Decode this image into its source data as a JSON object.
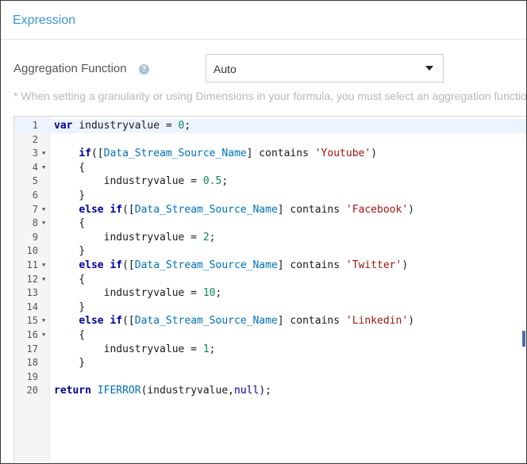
{
  "header": {
    "title": "Expression"
  },
  "aggregation": {
    "label": "Aggregation Function",
    "help_icon": "question-circle-icon",
    "selected": "Auto",
    "note": "* When setting a granularity or using Dimensions in your formula, you must select an aggregation function"
  },
  "editor": {
    "active_line": 1,
    "lines": [
      {
        "n": "1",
        "fold": false,
        "text": "var industryvalue = 0;"
      },
      {
        "n": "2",
        "fold": false,
        "text": ""
      },
      {
        "n": "3",
        "fold": true,
        "text": "    if([Data_Stream_Source_Name] contains 'Youtube')"
      },
      {
        "n": "4",
        "fold": true,
        "text": "    {"
      },
      {
        "n": "5",
        "fold": false,
        "text": "        industryvalue = 0.5;"
      },
      {
        "n": "6",
        "fold": false,
        "text": "    }"
      },
      {
        "n": "7",
        "fold": true,
        "text": "    else if([Data_Stream_Source_Name] contains 'Facebook')"
      },
      {
        "n": "8",
        "fold": true,
        "text": "    {"
      },
      {
        "n": "9",
        "fold": false,
        "text": "        industryvalue = 2;"
      },
      {
        "n": "10",
        "fold": false,
        "text": "    }"
      },
      {
        "n": "11",
        "fold": true,
        "text": "    else if([Data_Stream_Source_Name] contains 'Twitter')"
      },
      {
        "n": "12",
        "fold": true,
        "text": "    {"
      },
      {
        "n": "13",
        "fold": false,
        "text": "        industryvalue = 10;"
      },
      {
        "n": "14",
        "fold": false,
        "text": "    }"
      },
      {
        "n": "15",
        "fold": true,
        "text": "    else if([Data_Stream_Source_Name] contains 'Linkedin')"
      },
      {
        "n": "16",
        "fold": true,
        "text": "    {"
      },
      {
        "n": "17",
        "fold": false,
        "text": "        industryvalue = 1;"
      },
      {
        "n": "18",
        "fold": false,
        "text": "    }"
      },
      {
        "n": "19",
        "fold": false,
        "text": ""
      },
      {
        "n": "20",
        "fold": false,
        "text": "return IFERROR(industryvalue,null);"
      }
    ]
  }
}
